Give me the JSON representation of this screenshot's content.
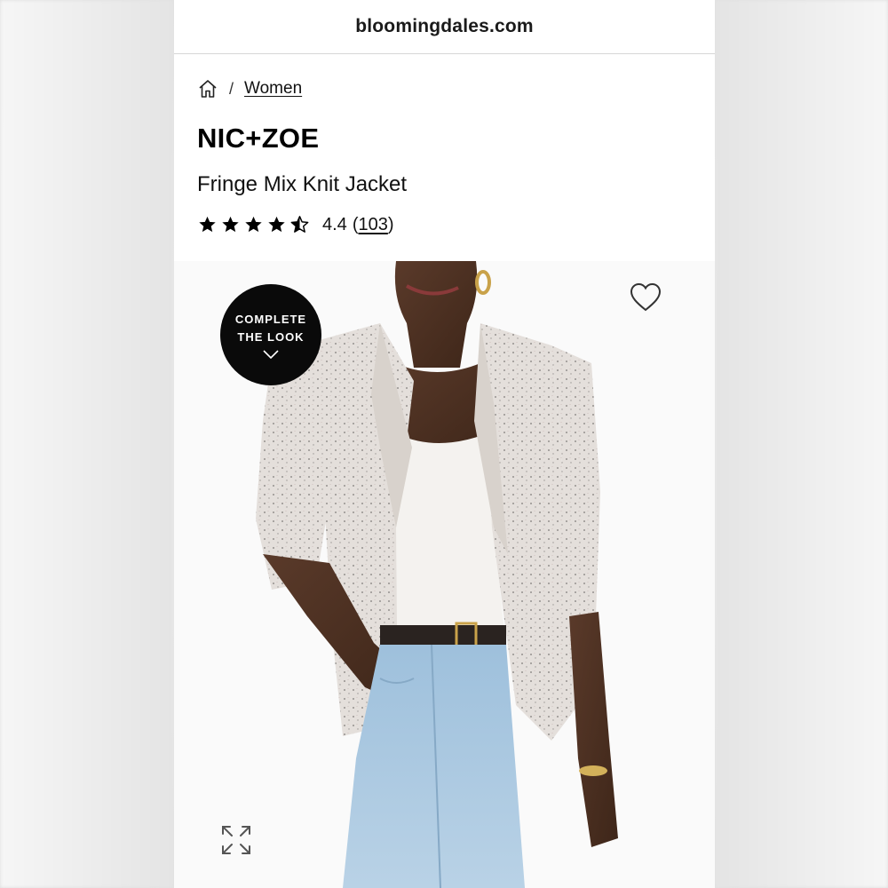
{
  "browser": {
    "url": "bloomingdales.com"
  },
  "breadcrumb": {
    "home_icon": "home-icon",
    "separator": "/",
    "items": [
      {
        "label": "Women"
      }
    ]
  },
  "product": {
    "brand": "NIC+ZOE",
    "name": "Fringe Mix Knit Jacket",
    "rating": {
      "value": "4.4",
      "stars": 4.4,
      "out_of": 5,
      "count_open": "(",
      "count": "103",
      "count_close": ")"
    }
  },
  "image": {
    "complete_the_look": {
      "line1": "COMPLETE",
      "line2": "THE LOOK",
      "icon": "chevron-down-icon"
    },
    "wishlist_icon": "heart-icon",
    "expand_icon": "expand-icon"
  },
  "colors": {
    "text": "#111111",
    "badge_bg": "#0a0a0a",
    "divider": "#d6d6d6"
  }
}
